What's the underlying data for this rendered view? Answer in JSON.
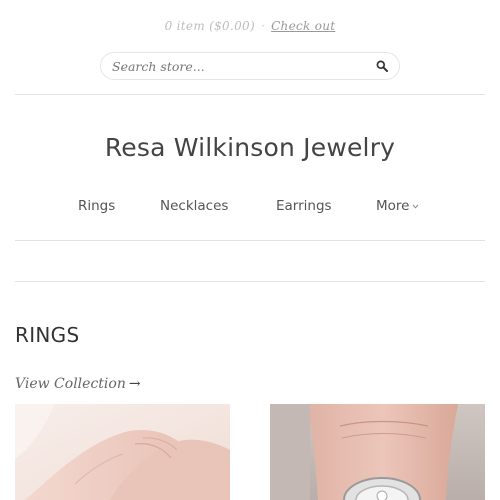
{
  "cart": {
    "summary": "0 item ($0.00)",
    "separator": "·",
    "checkout_label": "Check out"
  },
  "search": {
    "placeholder": "Search store..."
  },
  "site": {
    "title": "Resa Wilkinson Jewelry"
  },
  "nav": {
    "items": [
      {
        "label": "Rings"
      },
      {
        "label": "Necklaces"
      },
      {
        "label": "Earrings"
      },
      {
        "label": "More"
      }
    ]
  },
  "collection": {
    "title": "RINGS",
    "view_label": "View Collection",
    "view_arrow": "→"
  },
  "products": [
    {
      "icon": "hand-photo"
    },
    {
      "icon": "ring-on-finger-photo"
    }
  ],
  "colors": {
    "text": "#333333",
    "muted": "#bdbdbd",
    "divider": "#e2e2e2",
    "skin": "#e8c9bf"
  }
}
